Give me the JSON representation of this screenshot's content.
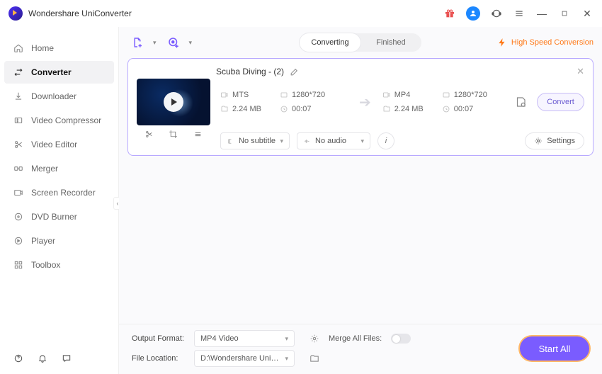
{
  "app": {
    "title": "Wondershare UniConverter"
  },
  "titlebar_icons": {
    "gift": "gift-icon",
    "avatar": "user-avatar",
    "support": "support-icon",
    "menu": "menu-icon",
    "min": "—",
    "max": "▢",
    "close": "✕"
  },
  "sidebar": {
    "items": [
      {
        "key": "home",
        "label": "Home"
      },
      {
        "key": "converter",
        "label": "Converter",
        "active": true
      },
      {
        "key": "downloader",
        "label": "Downloader"
      },
      {
        "key": "compressor",
        "label": "Video Compressor"
      },
      {
        "key": "editor",
        "label": "Video Editor"
      },
      {
        "key": "merger",
        "label": "Merger"
      },
      {
        "key": "screen",
        "label": "Screen Recorder"
      },
      {
        "key": "dvd",
        "label": "DVD Burner"
      },
      {
        "key": "player",
        "label": "Player"
      },
      {
        "key": "toolbox",
        "label": "Toolbox"
      }
    ]
  },
  "tabs": {
    "converting": "Converting",
    "finished": "Finished",
    "active": "converting"
  },
  "hsc": {
    "label": "High Speed Conversion"
  },
  "file": {
    "name": "Scuba Diving - (2)",
    "src": {
      "format": "MTS",
      "resolution": "1280*720",
      "size": "2.24 MB",
      "duration": "00:07"
    },
    "dst": {
      "format": "MP4",
      "resolution": "1280*720",
      "size": "2.24 MB",
      "duration": "00:07"
    },
    "convert_label": "Convert",
    "subtitle_select": "No subtitle",
    "audio_select": "No audio",
    "settings_label": "Settings"
  },
  "footer": {
    "output_format_label": "Output Format:",
    "output_format_value": "MP4 Video",
    "file_location_label": "File Location:",
    "file_location_value": "D:\\Wondershare UniConverter",
    "merge_label": "Merge All Files:",
    "start_all": "Start All"
  }
}
